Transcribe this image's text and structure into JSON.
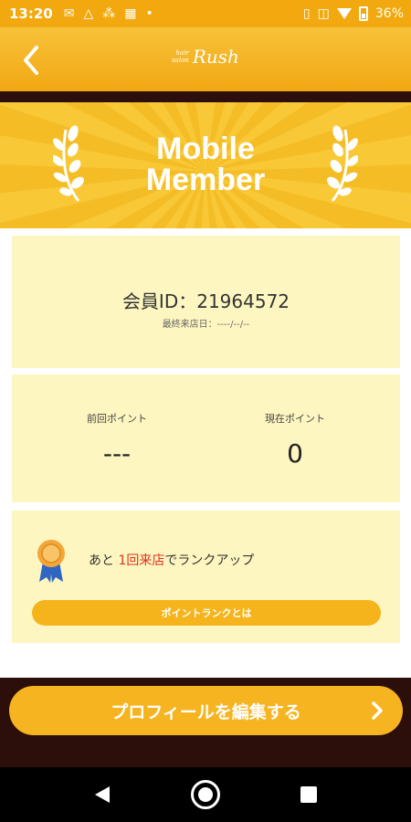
{
  "status_bar": {
    "time": "13:20",
    "battery": "36%"
  },
  "app_bar": {
    "logo_small_top": "hair",
    "logo_small_bottom": "salon",
    "logo_name": "Rush"
  },
  "hero": {
    "title_line1": "Mobile",
    "title_line2": "Member"
  },
  "member": {
    "id_text": "会員ID：21964572",
    "last_visit": "最終来店日：----/--/--"
  },
  "points": {
    "previous_label": "前回ポイント",
    "previous_value": "---",
    "current_label": "現在ポイント",
    "current_value": "0"
  },
  "rank": {
    "prefix": "あと",
    "highlight": "1回来店",
    "suffix": "でランクアップ",
    "button_label": "ポイントランクとは"
  },
  "footer": {
    "profile_button": "プロフィールを編集する"
  },
  "colors": {
    "accent": "#f5b41b",
    "dark": "#2c0f0a",
    "card": "#fef6c0",
    "highlight_text": "#e0301e"
  }
}
